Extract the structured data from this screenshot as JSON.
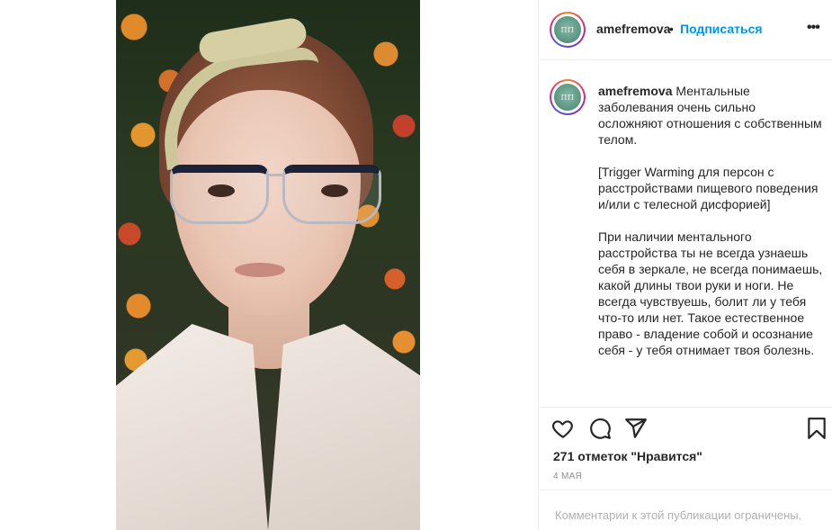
{
  "post": {
    "username": "amefremova",
    "separator": "•",
    "follow_label": "Подписаться",
    "more_label": "•••",
    "avatar_text": "ΠΠ",
    "caption_user": "amefremova",
    "caption_text": " Ментальные заболевания очень сильно осложняют отношения с собственным телом.\n\n[Trigger Warming для персон с расстройствами пищевого поведения и/или с телесной дисфорией]\n\nПри наличии ментального расстройства ты не всегда узнаешь себя в зеркале, не всегда понимаешь, какой длины твои руки и ноги. Не всегда чувствуешь, болит ли у тебя что-то или нет. Такое естественное право - владение собой и осознание себя - у тебя отнимает твоя болезнь.",
    "likes": "271 отметок \"Нравится\"",
    "date": "4 мая",
    "comments_disabled": "Комментарии к этой публикации ограничены."
  },
  "icons": [
    "heart-icon",
    "comment-icon",
    "share-icon",
    "bookmark-icon"
  ],
  "colors": {
    "accent": "#0095f6",
    "text": "#262626",
    "muted": "#8e8e8e",
    "border": "#efefef"
  }
}
